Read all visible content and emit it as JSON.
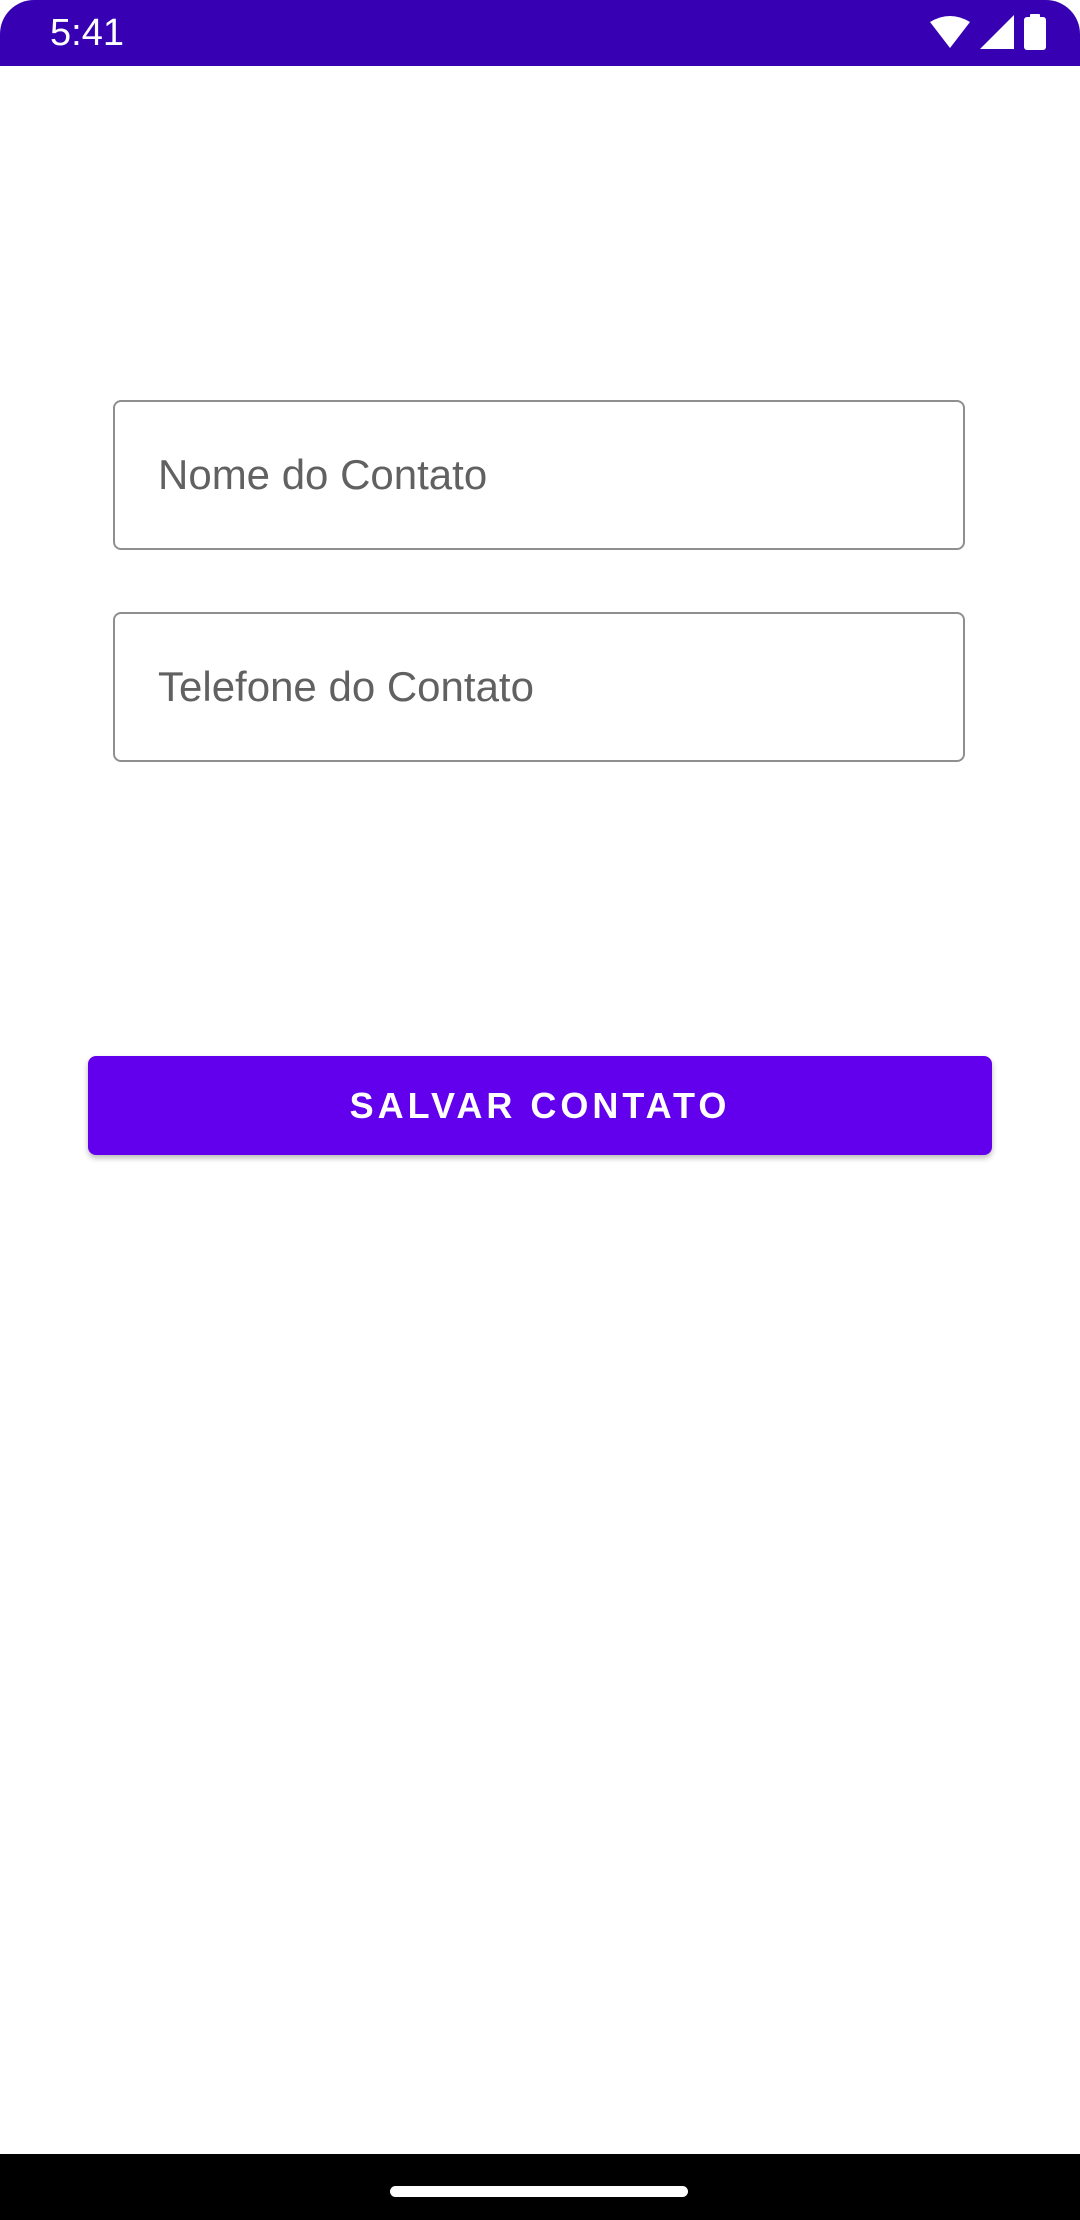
{
  "status_bar": {
    "time": "5:41",
    "color": "#3700b3",
    "icons": [
      "wifi-icon",
      "signal-icon",
      "battery-icon"
    ]
  },
  "form": {
    "name_field": {
      "placeholder": "Nome do Contato",
      "value": ""
    },
    "phone_field": {
      "placeholder": "Telefone do Contato",
      "value": ""
    }
  },
  "save_button": {
    "label": "SALVAR CONTATO",
    "color": "#6200ee"
  }
}
